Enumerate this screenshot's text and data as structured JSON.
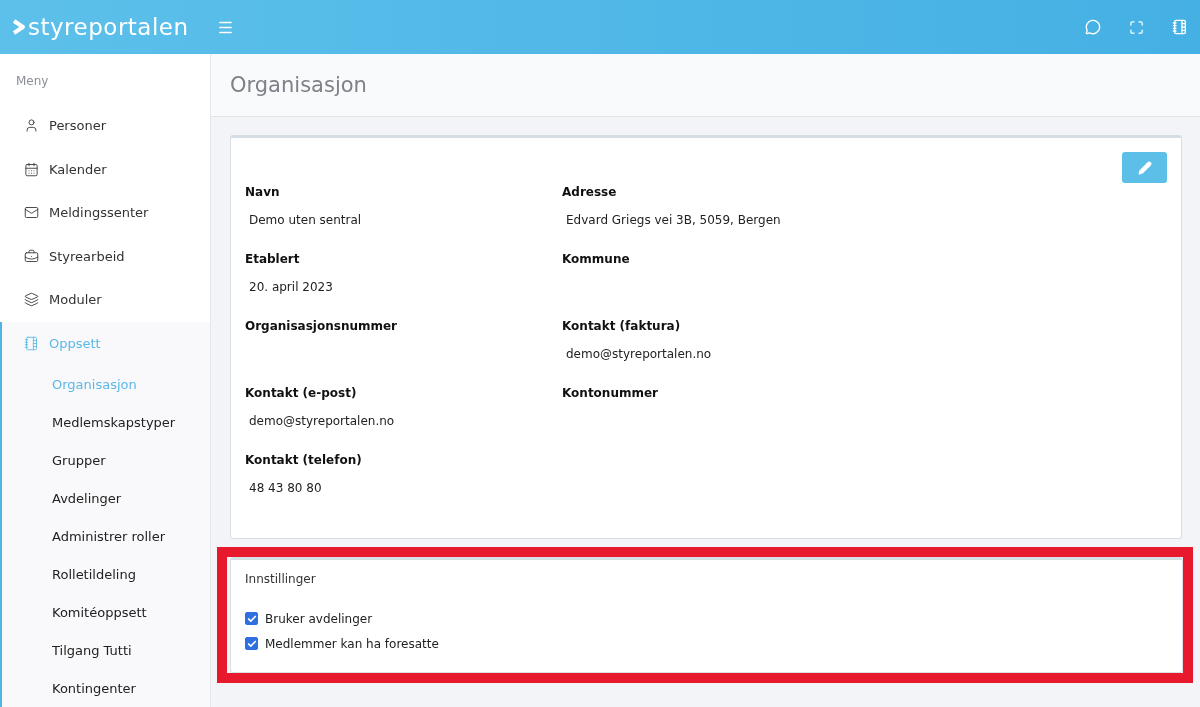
{
  "header": {
    "logo": "styreportalen"
  },
  "sidebar": {
    "heading": "Meny",
    "items": [
      {
        "label": "Personer",
        "selected": false
      },
      {
        "label": "Kalender",
        "selected": false
      },
      {
        "label": "Meldingssenter",
        "selected": false
      },
      {
        "label": "Styrearbeid",
        "selected": false
      },
      {
        "label": "Moduler",
        "selected": false
      },
      {
        "label": "Oppsett",
        "selected": true,
        "expanded": true,
        "children": [
          {
            "label": "Organisasjon",
            "selected": true
          },
          {
            "label": "Medlemskapstyper",
            "selected": false
          },
          {
            "label": "Grupper",
            "selected": false
          },
          {
            "label": "Avdelinger",
            "selected": false
          },
          {
            "label": "Administrer roller",
            "selected": false
          },
          {
            "label": "Rolletildeling",
            "selected": false
          },
          {
            "label": "Komitéoppsett",
            "selected": false
          },
          {
            "label": "Tilgang Tutti",
            "selected": false
          },
          {
            "label": "Kontingenter",
            "selected": false
          }
        ]
      }
    ]
  },
  "page": {
    "title": "Organisasjon"
  },
  "details": {
    "left": [
      {
        "label": "Navn",
        "value": "Demo uten sentral"
      },
      {
        "label": "Etablert",
        "value": "20. april 2023"
      },
      {
        "label": "Organisasjonsnummer"
      },
      {
        "label": "Kontakt (e-post)",
        "value": "demo@styreportalen.no"
      },
      {
        "label": "Kontakt (telefon)",
        "value": "48 43 80 80"
      }
    ],
    "right": [
      {
        "label": "Adresse",
        "value": "Edvard Griegs vei 3B, 5059, Bergen"
      },
      {
        "label": "Kommune"
      },
      {
        "label": "Kontakt (faktura)",
        "value": "demo@styreportalen.no"
      },
      {
        "label": "Kontonummer"
      }
    ]
  },
  "settings": {
    "title": "Innstillinger",
    "highlighted": true,
    "options": [
      {
        "label": "Bruker avdelinger",
        "checked": true
      },
      {
        "label": "Medlemmer kan ha foresatte",
        "checked": true
      }
    ]
  }
}
